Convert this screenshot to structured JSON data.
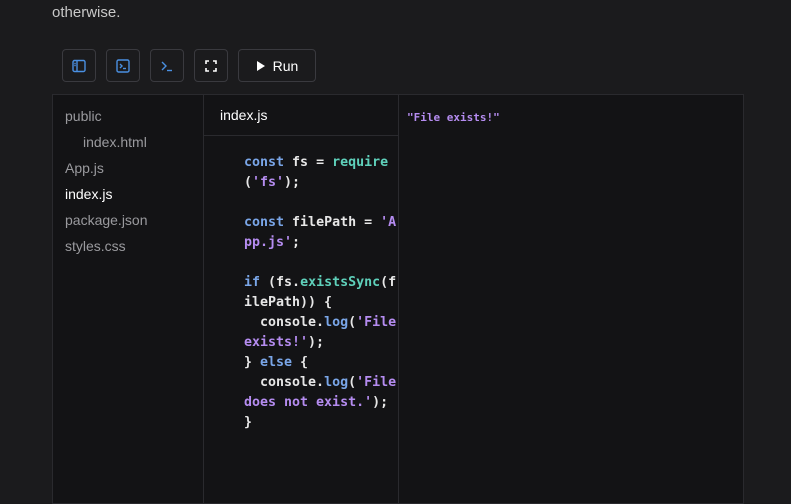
{
  "intro": {
    "text": "otherwise."
  },
  "toolbar": {
    "buttons": [
      {
        "icon": "sidebar-panel-icon"
      },
      {
        "icon": "terminal-box-icon"
      },
      {
        "icon": "terminal-prompt-icon"
      },
      {
        "icon": "fullscreen-icon"
      }
    ],
    "run_label": "Run"
  },
  "sidebar": {
    "files": [
      {
        "label": "public",
        "indent": false,
        "active": false
      },
      {
        "label": "index.html",
        "indent": true,
        "active": false
      },
      {
        "label": "App.js",
        "indent": false,
        "active": false
      },
      {
        "label": "index.js",
        "indent": false,
        "active": true
      },
      {
        "label": "package.json",
        "indent": false,
        "active": false
      },
      {
        "label": "styles.css",
        "indent": false,
        "active": false
      }
    ]
  },
  "editor": {
    "tab_label": "index.js",
    "lines": [
      [
        [
          "kw",
          "const "
        ],
        [
          "p",
          "fs = "
        ],
        [
          "fn",
          "require"
        ]
      ],
      [
        [
          "p",
          "("
        ],
        [
          "str",
          "'fs'"
        ],
        [
          "p",
          ");"
        ]
      ],
      [],
      [
        [
          "kw",
          "const "
        ],
        [
          "p",
          "filePath = "
        ],
        [
          "str",
          "'A"
        ]
      ],
      [
        [
          "str",
          "pp.js'"
        ],
        [
          "p",
          ";"
        ]
      ],
      [],
      [
        [
          "kw",
          "if "
        ],
        [
          "p",
          "(fs."
        ],
        [
          "fn",
          "existsSync"
        ],
        [
          "p",
          "(f"
        ]
      ],
      [
        [
          "p",
          "ilePath)) {"
        ]
      ],
      [
        [
          "p",
          "  console."
        ],
        [
          "kw",
          "log"
        ],
        [
          "p",
          "("
        ],
        [
          "str",
          "'File"
        ]
      ],
      [
        [
          "str",
          "exists!'"
        ],
        [
          "p",
          ");"
        ]
      ],
      [
        [
          "p",
          "} "
        ],
        [
          "kw",
          "else"
        ],
        [
          "p",
          " {"
        ]
      ],
      [
        [
          "p",
          "  console."
        ],
        [
          "kw",
          "log"
        ],
        [
          "p",
          "("
        ],
        [
          "str",
          "'File"
        ]
      ],
      [
        [
          "str",
          "does not exist."
        ],
        [
          "str",
          "'"
        ],
        [
          "p",
          ");"
        ]
      ],
      [
        [
          "p",
          "}"
        ]
      ]
    ]
  },
  "preview": {
    "output": "\"File exists!\""
  },
  "colors": {
    "background": "#1b1b1d",
    "keyword": "#7aa6e8",
    "function": "#5fd1bb",
    "string": "#b58cf0",
    "accent_icon": "#4a90e2"
  }
}
